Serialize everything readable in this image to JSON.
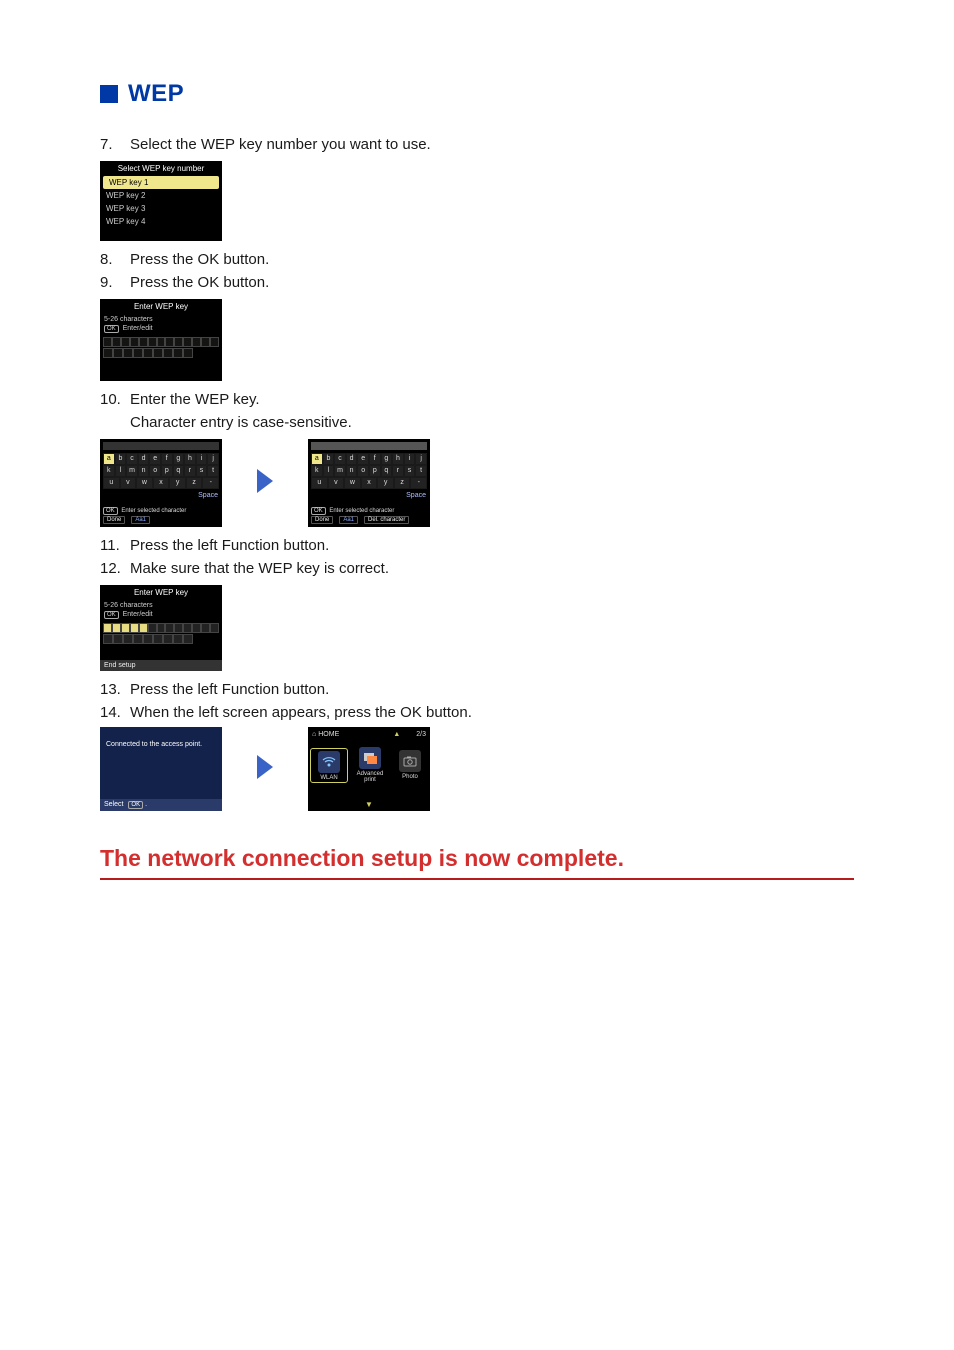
{
  "heading": {
    "wep": "WEP"
  },
  "steps": {
    "s7": {
      "num": "7.",
      "text": "Select the WEP key number you want to use."
    },
    "s8": {
      "num": "8.",
      "text": "Press the OK button."
    },
    "s9": {
      "num": "9.",
      "text": "Press the OK button."
    },
    "s10": {
      "num": "10.",
      "text": "Enter the WEP key.",
      "sub": "Character entry is case-sensitive."
    },
    "s11": {
      "num": "11.",
      "text": "Press the left Function button."
    },
    "s12": {
      "num": "12.",
      "text": "Make sure that the WEP key is correct."
    },
    "s13": {
      "num": "13.",
      "text": "Press the left Function button."
    },
    "s14": {
      "num": "14.",
      "text": "When the left screen appears, press the OK button."
    }
  },
  "lcd7": {
    "title": "Select WEP key number",
    "items": [
      "WEP key 1",
      "WEP key 2",
      "WEP key 3",
      "WEP key 4"
    ],
    "selected_index": 0
  },
  "lcd9": {
    "title": "Enter WEP key",
    "hint1": "5-26 characters",
    "hint2_btn": "OK",
    "hint2_text": "Enter/edit"
  },
  "kb": {
    "rows": [
      [
        "a",
        "b",
        "c",
        "d",
        "e",
        "f",
        "g",
        "h",
        "i",
        "j"
      ],
      [
        "k",
        "l",
        "m",
        "n",
        "o",
        "p",
        "q",
        "r",
        "s",
        "t"
      ],
      [
        "u",
        "v",
        "w",
        "x",
        "y",
        "z",
        "-"
      ]
    ],
    "selected": "a",
    "space_label": "Space",
    "hint_btn": "OK",
    "hint_text": "Enter selected character",
    "btn_done": "Done",
    "btn_aa1": "Aa1",
    "btn_del": "Del. character"
  },
  "lcd12": {
    "title": "Enter WEP key",
    "hint1": "5-26 characters",
    "hint2_btn": "OK",
    "hint2_text": "Enter/edit",
    "footer": "End setup"
  },
  "lcd14a": {
    "msg": "Connected to the access point.",
    "footer_label": "Select",
    "footer_btn": "OK"
  },
  "lcd14b": {
    "home_icon_label": "⌂",
    "home_label": "HOME",
    "page": "2/3",
    "tiles": [
      {
        "label": "WLAN"
      },
      {
        "label": "Advanced print"
      },
      {
        "label": "Photo"
      }
    ]
  },
  "final": "The network connection setup is now complete."
}
